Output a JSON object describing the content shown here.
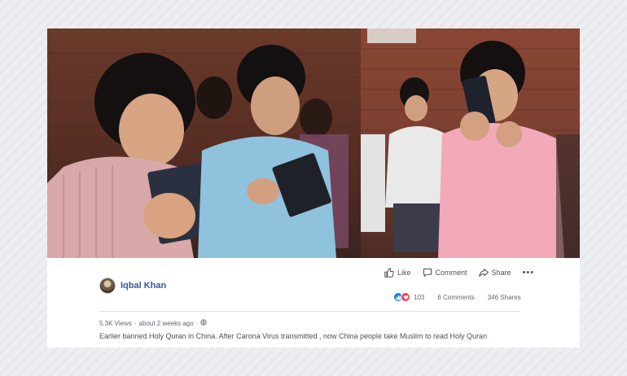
{
  "post": {
    "author": "Iqbal Khan",
    "views": "5.3K Views",
    "separator": "·",
    "time": "about 2 weeks ago",
    "time_separator": "·",
    "caption": "Earlier banned Holy Quran in China. After Carona Virus transmitted , now China people take Muslim to read Holy Quran"
  },
  "actions": {
    "like_label": "Like",
    "comment_label": "Comment",
    "share_label": "Share",
    "more_label": "•••"
  },
  "stats": {
    "reactions_count": "103",
    "comments": "6 Comments",
    "shares": "346 Shares"
  },
  "icons": {
    "like": "thumbs-up-icon",
    "comment": "speech-bubble-icon",
    "share": "share-arrow-icon",
    "more": "ellipsis-icon",
    "privacy": "globe-icon",
    "reaction_like": "like-reaction-icon",
    "reaction_love": "love-reaction-icon"
  },
  "colors": {
    "link": "#385898",
    "like_blue": "#1877f2",
    "love_red": "#f33e58",
    "muted_text": "#606770"
  }
}
